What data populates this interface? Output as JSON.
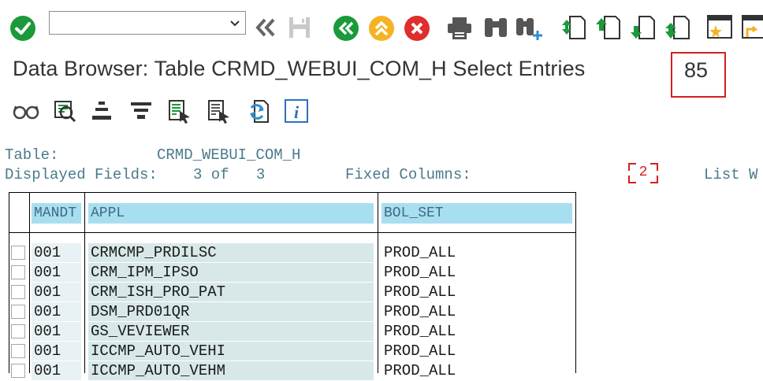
{
  "toolbar": {
    "command_field_value": "",
    "colors": {
      "green": "#1a9a3a",
      "yellow": "#f5b324",
      "red": "#e02d2d",
      "gray": "#555555"
    }
  },
  "title": {
    "text": "Data Browser: Table CRMD_WEBUI_COM_H Select Entries",
    "count": "85"
  },
  "info": {
    "table_label": "Table:",
    "table_value": "CRMD_WEBUI_COM_H",
    "displayed_label": "Displayed Fields:",
    "displayed_value": "3 of   3",
    "fixed_label": "Fixed Columns:",
    "fixed_value": "2",
    "list_label": "List W"
  },
  "table": {
    "columns": [
      "MANDT",
      "APPL",
      "BOL_SET"
    ],
    "rows": [
      [
        "001",
        "CRMCMP_PRDILSC",
        "PROD_ALL"
      ],
      [
        "001",
        "CRM_IPM_IPSO",
        "PROD_ALL"
      ],
      [
        "001",
        "CRM_ISH_PRO_PAT",
        "PROD_ALL"
      ],
      [
        "001",
        "DSM_PRD01QR",
        "PROD_ALL"
      ],
      [
        "001",
        "GS_VEVIEWER",
        "PROD_ALL"
      ],
      [
        "001",
        "ICCMP_AUTO_VEHI",
        "PROD_ALL"
      ],
      [
        "001",
        "ICCMP_AUTO_VEHM",
        "PROD_ALL"
      ]
    ]
  }
}
